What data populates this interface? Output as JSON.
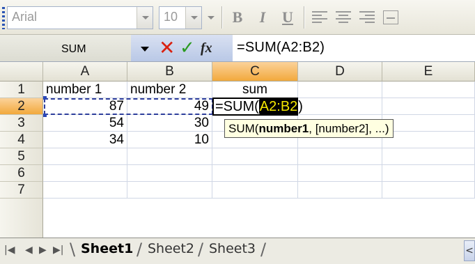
{
  "toolbar": {
    "font_name": "Arial",
    "font_size": "10",
    "bold_label": "B",
    "italic_label": "I",
    "underline_label": "U"
  },
  "formula_bar": {
    "name_box": "SUM",
    "cancel_icon": "✕",
    "enter_icon": "✓",
    "fx_label": "fx",
    "formula": "=SUM(A2:B2)"
  },
  "columns": [
    "A",
    "B",
    "C",
    "D",
    "E"
  ],
  "rows": [
    "1",
    "2",
    "3",
    "4",
    "5",
    "6",
    "7"
  ],
  "cells": {
    "A1": "number 1",
    "B1": "number 2",
    "C1": "sum",
    "A2": "87",
    "B2": "49",
    "A3": "54",
    "B3": "30",
    "A4": "34",
    "B4": "10"
  },
  "editing": {
    "prefix": "=SUM(",
    "reference": "A2:B2",
    "suffix": ")"
  },
  "tooltip": {
    "func": "SUM(",
    "bold_arg": "number1",
    "rest": ", [number2], ...)"
  },
  "sheets": [
    "Sheet1",
    "Sheet2",
    "Sheet3"
  ],
  "active_sheet": "Sheet1",
  "colors": {
    "active_header": "#f2a93c",
    "reference_highlight": "#f5e700",
    "cancel": "#d92110",
    "enter": "#2a9a20"
  }
}
